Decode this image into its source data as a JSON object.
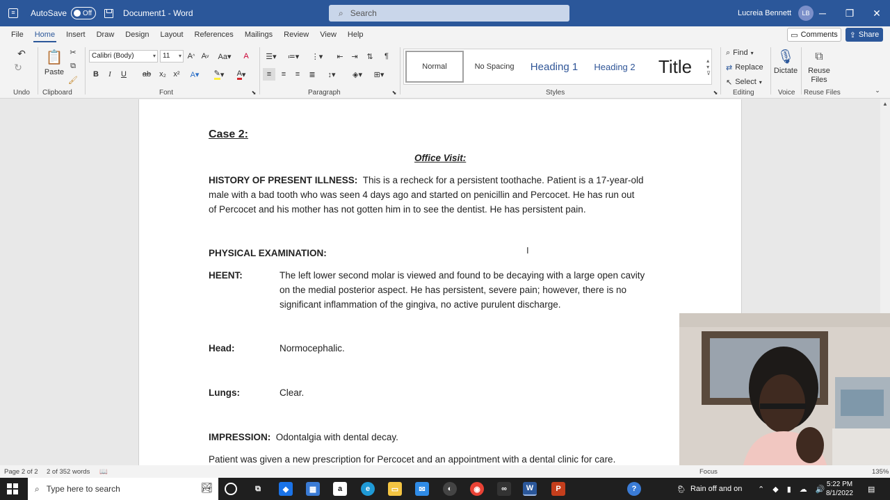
{
  "titlebar": {
    "autosave_label": "AutoSave",
    "autosave_state": "Off",
    "document_title": "Document1 - Word",
    "search_placeholder": "Search",
    "user_name": "Lucreia Bennett",
    "user_initials": "LB"
  },
  "tabs": [
    "File",
    "Home",
    "Insert",
    "Draw",
    "Design",
    "Layout",
    "References",
    "Mailings",
    "Review",
    "View",
    "Help"
  ],
  "tab_actions": {
    "comments": "Comments",
    "share": "Share"
  },
  "ribbon": {
    "undo_group": "Undo",
    "clipboard": {
      "paste": "Paste",
      "group": "Clipboard"
    },
    "font": {
      "name": "Calibri (Body)",
      "size": "11",
      "group": "Font"
    },
    "paragraph": {
      "group": "Paragraph"
    },
    "styles": {
      "items": [
        "Normal",
        "No Spacing",
        "Heading 1",
        "Heading 2",
        "Title"
      ],
      "group": "Styles"
    },
    "editing": {
      "find": "Find",
      "replace": "Replace",
      "select": "Select",
      "group": "Editing"
    },
    "voice": {
      "dictate": "Dictate",
      "group": "Voice"
    },
    "reuse": {
      "button_line1": "Reuse",
      "button_line2": "Files",
      "group": "Reuse Files"
    }
  },
  "document": {
    "case_title": "Case 2:",
    "visit_title": "Office Visit:",
    "hpi_label": "HISTORY OF PRESENT ILLNESS:",
    "hpi_line1": "This is a recheck for a persistent toothache.  Patient is a 17-year-old",
    "hpi_line2": "male with a bad tooth who was seen 4 days ago and started on penicillin and Percocet.  He has run out",
    "hpi_line3": "of Percocet and his mother has not gotten him in to see the dentist.  He has persistent pain.",
    "exam_label": "PHYSICAL EXAMINATION:",
    "heent_label": "HEENT:",
    "heent_line1": "The left lower second molar is viewed and found to be decaying with a large open cavity",
    "heent_line2": "on the medial posterior aspect.  He has persistent, severe pain; however, there is no",
    "heent_line3": "significant inflammation of the gingiva, no active purulent discharge.",
    "head_label": "Head:",
    "head_value": "Normocephalic.",
    "lungs_label": "Lungs:",
    "lungs_value": "Clear.",
    "impression_label": "IMPRESSION:",
    "impression_value": "Odontalgia with dental decay.",
    "plan_line": "Patient was given a new prescription for Percocet and an appointment with a dental clinic for care."
  },
  "statusbar": {
    "page": "Page 2 of 2",
    "words": "2 of 352 words",
    "focus": "Focus",
    "zoom": "135%"
  },
  "taskbar": {
    "search_placeholder": "Type here to search",
    "weather": "Rain off and on",
    "time": "5:22 PM",
    "date": "8/1/2022"
  },
  "colors": {
    "word_blue": "#2b579a",
    "ribbon_bg": "#f3f3f3",
    "canvas_bg": "#e8e8e8",
    "taskbar_bg": "#1f1f1f"
  }
}
